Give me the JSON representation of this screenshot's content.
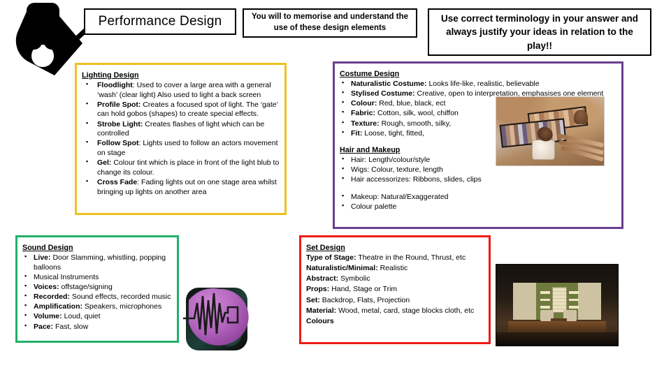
{
  "header": {
    "title": "Performance Design",
    "memorise_note": "You will to memorise and understand the use of these design elements",
    "terminology_note": "Use correct terminology in your answer and always justify your ideas in relation to the play!!",
    "logo_icon": "magnifier-hand-icon"
  },
  "colors": {
    "lighting_border": "#f0c020",
    "costume_border": "#6b3f8f",
    "sound_border": "#22b06a",
    "set_border": "#ed1c16",
    "title_border": "#000000",
    "background": "#ffffff"
  },
  "lighting": {
    "title": "Lighting Design",
    "items": [
      {
        "term": "Floodlight",
        "sep": ": ",
        "text": "Used to cover a large area with a general ‘wash’ (clear light) Also used to light a back screen"
      },
      {
        "term": "Profile Spot:",
        "sep": " ",
        "text": "Creates a focused spot of light. The ‘gate’ can hold gobos (shapes) to create special effects."
      },
      {
        "term": "Strobe Light:",
        "sep": " ",
        "text": "Creates flashes of light which can be controlled"
      },
      {
        "term": "Follow Spot",
        "sep": ": ",
        "text": "Lights used to follow an actors movement on stage"
      },
      {
        "term": "Gel:",
        "sep": " ",
        "text": "Colour tint which is place in front of the light blub to change its colour."
      },
      {
        "term": "Cross Fade",
        "sep": ": ",
        "text": "Fading lights out on one stage area whilst bringing up lights on another area"
      }
    ]
  },
  "costume": {
    "title": "Costume Design",
    "items": [
      {
        "term": "Naturalistic Costume:",
        "sep": " ",
        "text": "Looks life-like, realistic, believable"
      },
      {
        "term": "Stylised Costume:",
        "sep": " ",
        "text": "Creative, open to interpretation, emphasises one element"
      },
      {
        "term": "Colour:",
        "sep": " ",
        "text": "Red, blue, black, ect"
      },
      {
        "term": "Fabric:",
        "sep": "  ",
        "text": "Cotton, silk, wool, chiffon"
      },
      {
        "term": "Texture:",
        "sep": "  ",
        "text": "Rough, smooth, silky,"
      },
      {
        "term": "Fit:",
        "sep": " ",
        "text": "Loose, tight, fitted,"
      }
    ],
    "hair_title": "Hair and Makeup",
    "hair_items": [
      "Hair: Length/colour/style",
      "Wigs: Colour, texture, length",
      "Hair accessorizes: Ribbons, slides, clips"
    ],
    "makeup_items": [
      "Makeup: Natural/Exaggerated",
      "Colour palette"
    ],
    "photo_caption": "makeup-palettes-and-brushes-photo"
  },
  "sound": {
    "title": "Sound Design",
    "items": [
      {
        "term": "Live:",
        "sep": " ",
        "text": "Door Slamming, whistling, popping balloons"
      },
      {
        "term": "",
        "sep": "",
        "text": "Musical Instruments"
      },
      {
        "term": "Voices:",
        "sep": " ",
        "text": "offstage/signing"
      },
      {
        "term": "Recorded:",
        "sep": " ",
        "text": "Sound effects, recorded music"
      },
      {
        "term": "Amplification:",
        "sep": " ",
        "text": "Speakers, microphones"
      },
      {
        "term": "Volume:",
        "sep": " ",
        "text": "Loud, quiet"
      },
      {
        "term": "Pace:",
        "sep": " ",
        "text": "Fast, slow"
      }
    ],
    "icon_name": "audio-waveform-app-icon"
  },
  "set": {
    "title": "Set Design",
    "lines": [
      {
        "term": "Type of Stage:",
        "sep": " ",
        "text": "Theatre in the Round, Thrust, etc"
      },
      {
        "term": "Naturalistic/Minimal:",
        "sep": " ",
        "text": "Realistic"
      },
      {
        "term": "Abstract:",
        "sep": " ",
        "text": "Symbolic"
      },
      {
        "term": "Props:",
        "sep": " ",
        "text": "Hand, Stage or Trim"
      },
      {
        "term": "Set:",
        "sep": " ",
        "text": "Backdrop, Flats, Projection"
      },
      {
        "term": "Material:",
        "sep": " ",
        "text": "Wood, metal, card, stage blocks cloth, etc"
      },
      {
        "term": "Colours",
        "sep": "",
        "text": ""
      }
    ],
    "photo_caption": "theatre-set-living-room-photo"
  }
}
